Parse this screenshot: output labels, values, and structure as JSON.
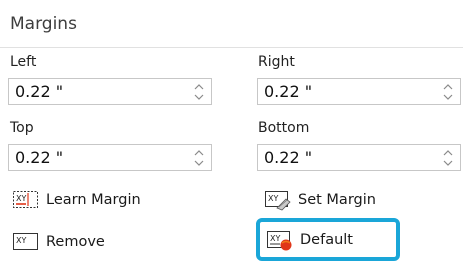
{
  "section": {
    "title": "Margins"
  },
  "fields": {
    "left": {
      "label": "Left",
      "value": "0.22 \""
    },
    "right": {
      "label": "Right",
      "value": "0.22 \""
    },
    "top": {
      "label": "Top",
      "value": "0.22 \""
    },
    "bottom": {
      "label": "Bottom",
      "value": "0.22 \""
    }
  },
  "buttons": {
    "learn_margin": {
      "label": "Learn Margin",
      "icon": "learn-margin-icon"
    },
    "set_margin": {
      "label": "Set Margin",
      "icon": "set-margin-icon"
    },
    "remove": {
      "label": "Remove",
      "icon": "remove-margin-icon"
    },
    "default": {
      "label": "Default",
      "icon": "default-margin-icon"
    }
  },
  "icon_text": "XY",
  "colors": {
    "highlight": "#1aa6d8",
    "accent_red": "#e0361a",
    "accent_orange": "#f07a1a"
  }
}
